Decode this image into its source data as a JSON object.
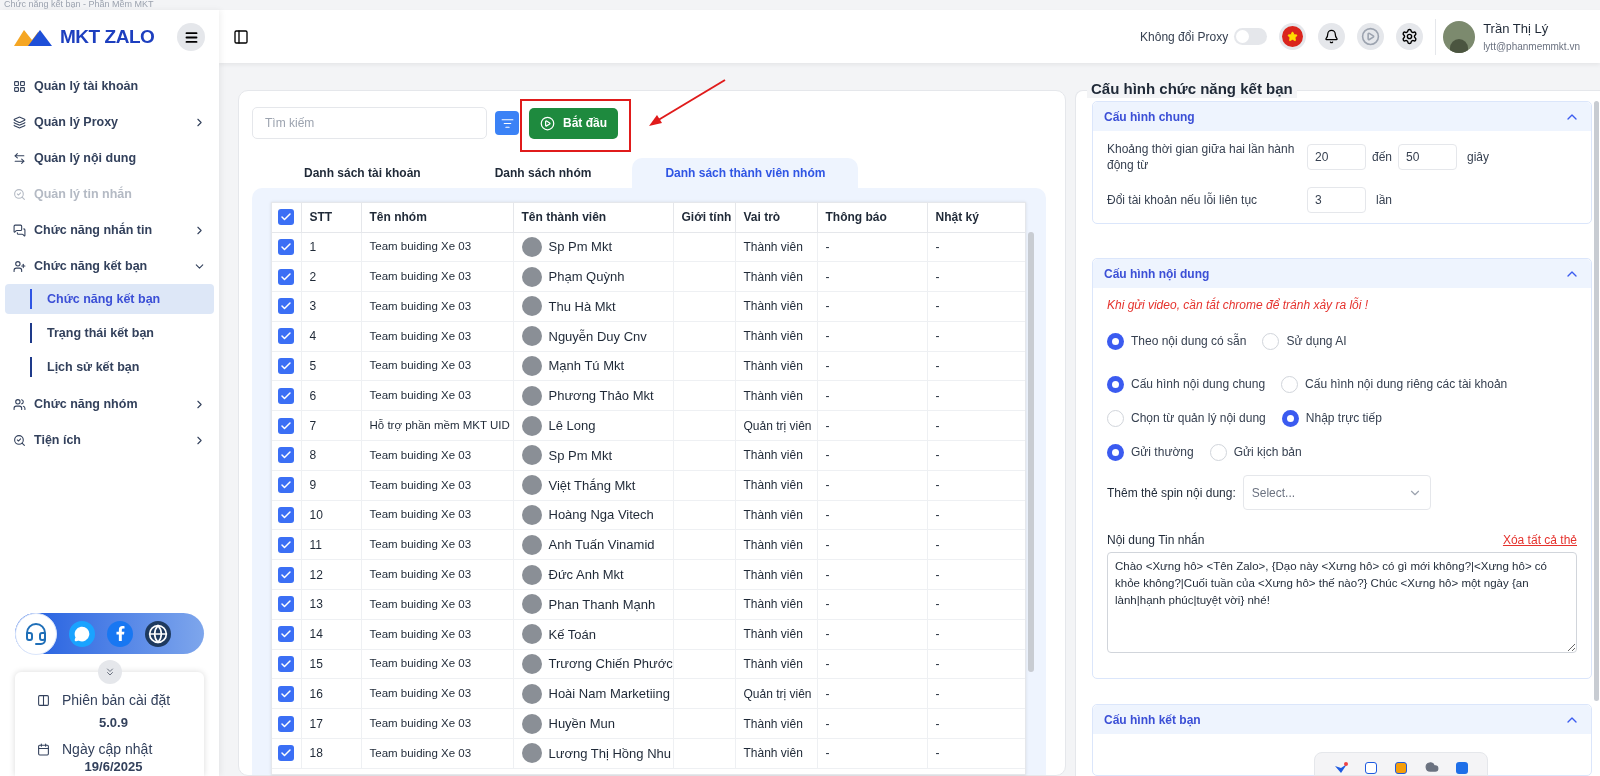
{
  "window": {
    "title": "Chức năng kết bạn - Phần Mềm MKT"
  },
  "sidebar": {
    "logo": "MKT ZALO",
    "items": [
      {
        "kind": "link",
        "label": "Quản lý tài khoản",
        "disabled": false
      },
      {
        "kind": "group",
        "label": "Quản lý Proxy",
        "expanded": false
      },
      {
        "kind": "link",
        "label": "Quản lý nội dung",
        "disabled": false
      },
      {
        "kind": "link",
        "label": "Quản lý tin nhắn",
        "disabled": true
      },
      {
        "kind": "group",
        "label": "Chức năng nhắn tin",
        "expanded": false
      },
      {
        "kind": "group",
        "label": "Chức năng kết bạn",
        "expanded": true,
        "children": [
          {
            "label": "Chức năng kết bạn",
            "selected": true
          },
          {
            "label": "Trạng thái kết bạn",
            "selected": false
          },
          {
            "label": "Lịch sử kết bạn",
            "selected": false
          }
        ]
      },
      {
        "kind": "group",
        "label": "Chức năng nhóm",
        "expanded": false
      },
      {
        "kind": "group",
        "label": "Tiện ích",
        "expanded": false
      }
    ],
    "version": {
      "label": "Phiên bản cài đặt",
      "value": "5.0.9"
    },
    "update": {
      "label": "Ngày cập nhật",
      "value": "19/6/2025"
    }
  },
  "header": {
    "proxy_toggle": {
      "label": "Không đổi Proxy",
      "on": false
    },
    "user": {
      "name": "Trần Thị Lý",
      "email": "lytt@phanmemmkt.vn"
    }
  },
  "toolbar": {
    "search": {
      "placeholder": "Tìm kiếm"
    },
    "start_button": "Bắt đầu"
  },
  "tabs": [
    {
      "label": "Danh sách tài khoản",
      "selected": false
    },
    {
      "label": "Danh sách nhóm",
      "selected": false
    },
    {
      "label": "Danh sách thành viên nhóm",
      "selected": true
    }
  ],
  "table": {
    "all_checked": true,
    "columns": [
      "STT",
      "Tên nhóm",
      "Tên thành viên",
      "Giới tính",
      "Vai trò",
      "Thông báo",
      "Nhật ký"
    ],
    "rows": [
      {
        "checked": true,
        "stt": "1",
        "group": "Team buiding Xe 03",
        "member": "Sp Pm Mkt",
        "role": "Thành viên",
        "notice": "-",
        "log": "-"
      },
      {
        "checked": true,
        "stt": "2",
        "group": "Team buiding Xe 03",
        "member": "Phạm Quỳnh",
        "role": "Thành viên",
        "notice": "-",
        "log": "-"
      },
      {
        "checked": true,
        "stt": "3",
        "group": "Team buiding Xe 03",
        "member": "Thu Hà Mkt",
        "role": "Thành viên",
        "notice": "-",
        "log": "-"
      },
      {
        "checked": true,
        "stt": "4",
        "group": "Team buiding Xe 03",
        "member": "Nguyễn Duy Cnv",
        "role": "Thành viên",
        "notice": "-",
        "log": "-"
      },
      {
        "checked": true,
        "stt": "5",
        "group": "Team buiding Xe 03",
        "member": "Mạnh Tú Mkt",
        "role": "Thành viên",
        "notice": "-",
        "log": "-"
      },
      {
        "checked": true,
        "stt": "6",
        "group": "Team buiding Xe 03",
        "member": "Phương Thảo Mkt",
        "role": "Thành viên",
        "notice": "-",
        "log": "-"
      },
      {
        "checked": true,
        "stt": "7",
        "group": "Hỗ trợ phần mềm MKT UID",
        "member": "Lê Long",
        "role": "Quản trị viên",
        "notice": "-",
        "log": "-"
      },
      {
        "checked": true,
        "stt": "8",
        "group": "Team buiding Xe 03",
        "member": "Sp Pm Mkt",
        "role": "Thành viên",
        "notice": "-",
        "log": "-"
      },
      {
        "checked": true,
        "stt": "9",
        "group": "Team buiding Xe 03",
        "member": "Việt Thắng Mkt",
        "role": "Thành viên",
        "notice": "-",
        "log": "-"
      },
      {
        "checked": true,
        "stt": "10",
        "group": "Team buiding Xe 03",
        "member": "Hoàng Nga Vitech",
        "role": "Thành viên",
        "notice": "-",
        "log": "-"
      },
      {
        "checked": true,
        "stt": "11",
        "group": "Team buiding Xe 03",
        "member": "Anh Tuấn Vinamid",
        "role": "Thành viên",
        "notice": "-",
        "log": "-"
      },
      {
        "checked": true,
        "stt": "12",
        "group": "Team buiding Xe 03",
        "member": "Đức Anh Mkt",
        "role": "Thành viên",
        "notice": "-",
        "log": "-"
      },
      {
        "checked": true,
        "stt": "13",
        "group": "Team buiding Xe 03",
        "member": "Phan Thanh Mạnh",
        "role": "Thành viên",
        "notice": "-",
        "log": "-"
      },
      {
        "checked": true,
        "stt": "14",
        "group": "Team buiding Xe 03",
        "member": "Kế Toán",
        "role": "Thành viên",
        "notice": "-",
        "log": "-"
      },
      {
        "checked": true,
        "stt": "15",
        "group": "Team buiding Xe 03",
        "member": "Trương Chiến Phước",
        "role": "Thành viên",
        "notice": "-",
        "log": "-"
      },
      {
        "checked": true,
        "stt": "16",
        "group": "Team buiding Xe 03",
        "member": "Hoài Nam Marketiing",
        "role": "Quản trị viên",
        "notice": "-",
        "log": "-"
      },
      {
        "checked": true,
        "stt": "17",
        "group": "Team buiding Xe 03",
        "member": "Huyền Mun",
        "role": "Thành viên",
        "notice": "-",
        "log": "-"
      },
      {
        "checked": true,
        "stt": "18",
        "group": "Team buiding Xe 03",
        "member": "Lương Thị Hồng Nhu",
        "role": "Thành viên",
        "notice": "-",
        "log": "-"
      }
    ]
  },
  "config": {
    "title": "Cấu hình chức năng kết bạn",
    "general": {
      "title": "Cấu hình chung",
      "expanded": true,
      "interval_label": "Khoảng thời gian giữa hai lần hành động từ",
      "from": "20",
      "to_label": "đến",
      "to": "50",
      "unit": "giây",
      "switch_label": "Đổi tài khoản nếu lỗi liên tục",
      "switch_count": "3",
      "switch_unit": "lần"
    },
    "content": {
      "title": "Cấu hình nội dung",
      "expanded": true,
      "warning": "Khi gửi video, cần tắt chrome để tránh xảy ra lỗi !",
      "radio_groups": [
        [
          {
            "label": "Theo nội dung có sẵn",
            "selected": true
          },
          {
            "label": "Sử dụng AI",
            "selected": false
          }
        ],
        [
          {
            "label": "Cấu hình nội dung chung",
            "selected": true
          },
          {
            "label": "Cấu hình nội dung riêng các tài khoản",
            "selected": false
          }
        ],
        [
          {
            "label": "Chọn từ quản lý nội dung",
            "selected": false
          },
          {
            "label": "Nhập trực tiếp",
            "selected": true
          }
        ],
        [
          {
            "label": "Gửi thường",
            "selected": true
          },
          {
            "label": "Gửi kịch bản",
            "selected": false
          }
        ]
      ],
      "spin_label": "Thêm thẻ spin nội dung:",
      "spin_placeholder": "Select...",
      "message_label": "Nội dung Tin nhắn",
      "clear_link": "Xóa tất cả thẻ",
      "message": "Chào <Xưng hô> <Tên Zalo>, {Dạo này <Xưng hô> có gì mới không?|<Xưng hô> có khỏe không?|Cuối tuần của <Xưng hô> thế nào?} Chúc <Xưng hô> một ngày {an lành|hạnh phúc|tuyệt vời} nhé!"
    },
    "friend": {
      "title": "Cấu hình kết bạn",
      "expanded": true
    }
  }
}
